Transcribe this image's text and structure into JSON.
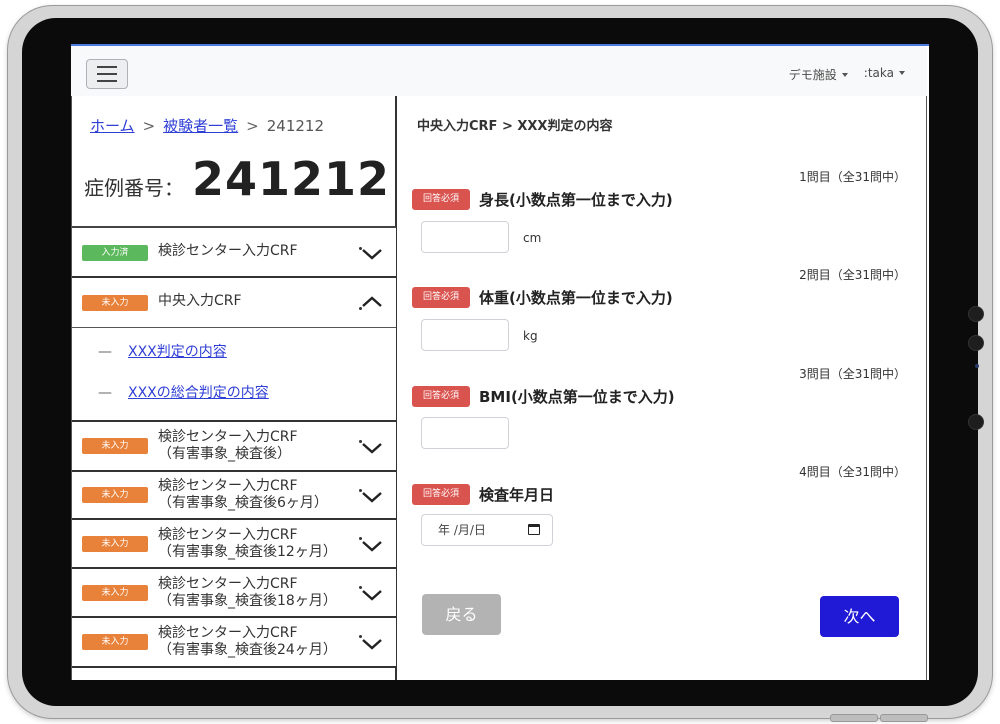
{
  "topbar": {
    "facility": "デモ施設",
    "user": ":taka"
  },
  "sidebar": {
    "breadcrumb": {
      "home": "ホーム",
      "sep": ">",
      "subjects": "被験者一覧",
      "current": "241212"
    },
    "case_label": "症例番号：",
    "case_number": "241212",
    "sections": [
      {
        "status": "入力済",
        "title": "検診センター入力CRF",
        "expanded": false
      },
      {
        "status": "未入力",
        "title": "中央入力CRF",
        "expanded": true,
        "subitems": [
          {
            "dash": "—",
            "label": "XXX判定の内容"
          },
          {
            "dash": "—",
            "label": "XXXの総合判定の内容"
          }
        ]
      },
      {
        "status": "未入力",
        "title": "検診センター入力CRF",
        "subtitle": "（有害事象_検査後）",
        "expanded": false
      },
      {
        "status": "未入力",
        "title": "検診センター入力CRF",
        "subtitle": "（有害事象_検査後6ヶ月）",
        "expanded": false
      },
      {
        "status": "未入力",
        "title": "検診センター入力CRF",
        "subtitle": "（有害事象_検査後12ヶ月）",
        "expanded": false
      },
      {
        "status": "未入力",
        "title": "検診センター入力CRF",
        "subtitle": "（有害事象_検査後18ヶ月）",
        "expanded": false
      },
      {
        "status": "未入力",
        "title": "検診センター入力CRF",
        "subtitle": "（有害事象_検査後24ヶ月）",
        "expanded": false
      }
    ]
  },
  "main": {
    "breadcrumb": "中央入力CRF > XXX判定の内容",
    "required_label": "回答必須",
    "questions": [
      {
        "count": "1問目（全31問中）",
        "title": "身長(小数点第一位まで入力)",
        "value": "",
        "unit": "cm"
      },
      {
        "count": "2問目（全31問中）",
        "title": "体重(小数点第一位まで入力)",
        "value": "",
        "unit": "kg"
      },
      {
        "count": "3問目（全31問中）",
        "title": "BMI(小数点第一位まで入力)",
        "value": "",
        "unit": ""
      },
      {
        "count": "4問目（全31問中）",
        "title": "検査年月日",
        "placeholder": "年 /月/日"
      }
    ],
    "back_label": "戻る",
    "next_label": "次へ"
  },
  "colors": {
    "accent_next": "#2019d6",
    "badge_done": "#5cb85c",
    "badge_todo": "#e8813a",
    "required": "#d9534f",
    "link": "#2f3fd6"
  }
}
